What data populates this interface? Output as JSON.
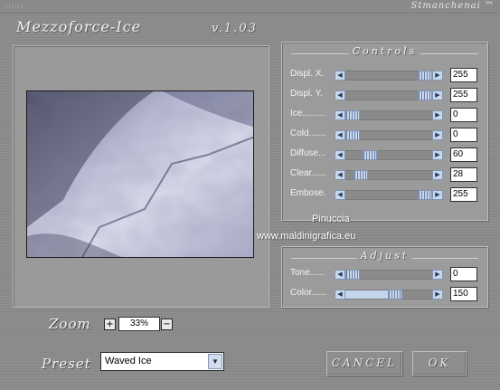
{
  "header": {
    "grip": "::::::",
    "brand": "Stmanchenai ™",
    "title": "Mezzoforce-Ice",
    "version": "v.1.03"
  },
  "controls": {
    "title": "Controls",
    "rows": [
      {
        "label": "Displ. X.",
        "value": "255",
        "level": 1.0
      },
      {
        "label": "Displ. Y.",
        "value": "255",
        "level": 1.0
      },
      {
        "label": "Ice.........",
        "value": "0",
        "level": 0.0
      },
      {
        "label": "Cold.......",
        "value": "0",
        "level": 0.0
      },
      {
        "label": "Diffuse...",
        "value": "60",
        "level": 0.24
      },
      {
        "label": "Clear......",
        "value": "28",
        "level": 0.11
      },
      {
        "label": "Embose.",
        "value": "255",
        "level": 1.0
      }
    ]
  },
  "adjust": {
    "title": "Adjust",
    "rows": [
      {
        "label": "Tone......",
        "value": "0",
        "level": 0.0
      },
      {
        "label": "Color......",
        "value": "150",
        "level": 0.59
      }
    ]
  },
  "zoom": {
    "label": "Zoom",
    "value": "33%",
    "plus": "+",
    "minus": "−"
  },
  "preset": {
    "label": "Preset",
    "value": "Waved Ice"
  },
  "buttons": {
    "cancel": "CANCEL",
    "ok": "OK"
  },
  "watermark": {
    "line1": "Pinuccia",
    "line2": "www.maldinigrafica.eu"
  },
  "colors": {
    "accent": "#c9d7ea",
    "panel": "#9b9b9b",
    "preview_tint": "#c4c6dc"
  }
}
